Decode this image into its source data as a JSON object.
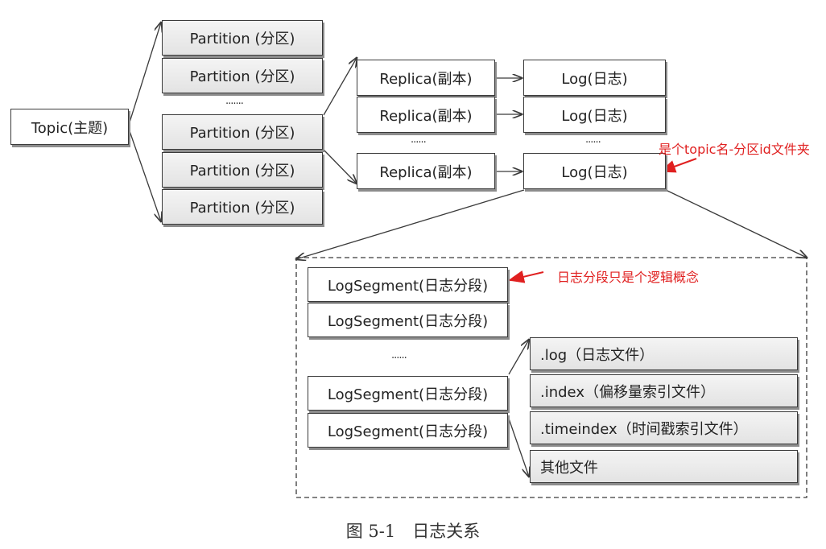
{
  "topic": "Topic(主题)",
  "partitions": [
    "Partition (分区)",
    "Partition (分区)",
    "Partition (分区)",
    "Partition (分区)",
    "Partition (分区)"
  ],
  "partition_ellipsis": "·······",
  "replicas": [
    "Replica(副本)",
    "Replica(副本)",
    "Replica(副本)"
  ],
  "replica_ellipsis": "······",
  "logs": [
    "Log(日志)",
    "Log(日志)",
    "Log(日志)"
  ],
  "log_ellipsis": "······",
  "log_note": "是个topic名-分区id文件夹",
  "segments": [
    "LogSegment(日志分段)",
    "LogSegment(日志分段)",
    "LogSegment(日志分段)",
    "LogSegment(日志分段)"
  ],
  "segment_ellipsis": "······",
  "segment_note": "日志分段只是个逻辑概念",
  "files": [
    ".log（日志文件）",
    ".index（偏移量索引文件）",
    ".timeindex（时间戳索引文件）",
    "其他文件"
  ],
  "caption": "图 5-1　日志关系",
  "colors": {
    "note": "#e02020",
    "line": "#3a3a3a"
  }
}
